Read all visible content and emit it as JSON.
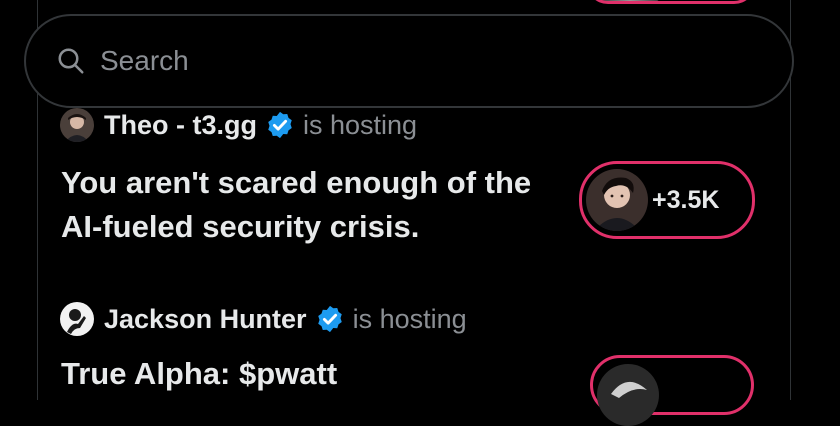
{
  "search": {
    "placeholder": "Search"
  },
  "spaces": [
    {
      "host": "Theo - t3.gg",
      "hosting_text": "is hosting",
      "title": "You aren't scared enough of the AI-fueled security crisis.",
      "listeners": "+3.5K"
    },
    {
      "host": "Jackson Hunter",
      "hosting_text": "is hosting",
      "title": "True Alpha: $pwatt"
    }
  ],
  "colors": {
    "background": "#000000",
    "verified_badge": "#1d9bf0",
    "live_ring": "#e0306a",
    "secondary_text": "#8b8f94"
  }
}
